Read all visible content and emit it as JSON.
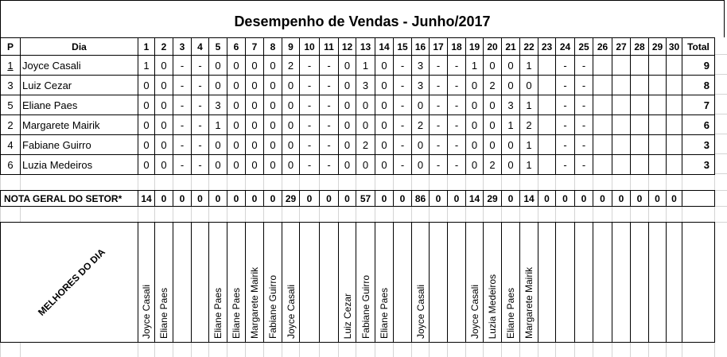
{
  "title": "Desempenho de Vendas - Junho/2017",
  "headers": {
    "pos": "P",
    "name": "Dia",
    "days": [
      "1",
      "2",
      "3",
      "4",
      "5",
      "6",
      "7",
      "8",
      "9",
      "10",
      "11",
      "12",
      "13",
      "14",
      "15",
      "16",
      "17",
      "18",
      "19",
      "20",
      "21",
      "22",
      "23",
      "24",
      "25",
      "26",
      "27",
      "28",
      "29",
      "30"
    ],
    "total": "Total"
  },
  "rows": [
    {
      "pos": "1",
      "name": "Joyce Casali",
      "days": [
        "1",
        "0",
        "-",
        "-",
        "0",
        "0",
        "0",
        "0",
        "2",
        "-",
        "-",
        "0",
        "1",
        "0",
        "-",
        "3",
        "-",
        "-",
        "1",
        "0",
        "0",
        "1",
        "",
        "-",
        "-",
        "",
        "",
        "",
        "",
        ""
      ],
      "total": "9"
    },
    {
      "pos": "3",
      "name": "Luiz Cezar",
      "days": [
        "0",
        "0",
        "-",
        "-",
        "0",
        "0",
        "0",
        "0",
        "0",
        "-",
        "-",
        "0",
        "3",
        "0",
        "-",
        "3",
        "-",
        "-",
        "0",
        "2",
        "0",
        "0",
        "",
        "-",
        "-",
        "",
        "",
        "",
        "",
        ""
      ],
      "total": "8"
    },
    {
      "pos": "5",
      "name": "Eliane Paes",
      "days": [
        "0",
        "0",
        "-",
        "-",
        "3",
        "0",
        "0",
        "0",
        "0",
        "-",
        "-",
        "0",
        "0",
        "0",
        "-",
        "0",
        "-",
        "-",
        "0",
        "0",
        "3",
        "1",
        "",
        "-",
        "-",
        "",
        "",
        "",
        "",
        ""
      ],
      "total": "7"
    },
    {
      "pos": "2",
      "name": "Margarete Mairik",
      "days": [
        "0",
        "0",
        "-",
        "-",
        "1",
        "0",
        "0",
        "0",
        "0",
        "-",
        "-",
        "0",
        "0",
        "0",
        "-",
        "2",
        "-",
        "-",
        "0",
        "0",
        "1",
        "2",
        "",
        "-",
        "-",
        "",
        "",
        "",
        "",
        ""
      ],
      "total": "6"
    },
    {
      "pos": "4",
      "name": "Fabiane Guirro",
      "days": [
        "0",
        "0",
        "-",
        "-",
        "0",
        "0",
        "0",
        "0",
        "0",
        "-",
        "-",
        "0",
        "2",
        "0",
        "-",
        "0",
        "-",
        "-",
        "0",
        "0",
        "0",
        "1",
        "",
        "-",
        "-",
        "",
        "",
        "",
        "",
        ""
      ],
      "total": "3"
    },
    {
      "pos": "6",
      "name": "Luzia Medeiros",
      "days": [
        "0",
        "0",
        "-",
        "-",
        "0",
        "0",
        "0",
        "0",
        "0",
        "-",
        "-",
        "0",
        "0",
        "0",
        "-",
        "0",
        "-",
        "-",
        "0",
        "2",
        "0",
        "1",
        "",
        "-",
        "-",
        "",
        "",
        "",
        "",
        ""
      ],
      "total": "3"
    }
  ],
  "nota": {
    "label": "NOTA GERAL DO SETOR*",
    "values": [
      "14",
      "0",
      "0",
      "0",
      "0",
      "0",
      "0",
      "0",
      "29",
      "0",
      "0",
      "0",
      "57",
      "0",
      "0",
      "86",
      "0",
      "0",
      "14",
      "29",
      "0",
      "14",
      "0",
      "0",
      "0",
      "0",
      "0",
      "0",
      "0",
      "0"
    ]
  },
  "melhores": {
    "label": "MELHORES DO DIA",
    "values": [
      "Joyce Casali",
      "Eliane Paes",
      "",
      "",
      "Eliane Paes",
      "Eliane Paes",
      "Margarete Mairik",
      "Fabiane Guirro",
      "Joyce Casali",
      "",
      "",
      "Luiz Cezar",
      "Fabiane Guirro",
      "Eliane Paes",
      "",
      "Joyce Casali",
      "",
      "",
      "Joyce Casali",
      "Luzia Medeiros",
      "Eliane Paes",
      "Margarete Mairik",
      "",
      "",
      "",
      "",
      "",
      "",
      "",
      ""
    ]
  }
}
